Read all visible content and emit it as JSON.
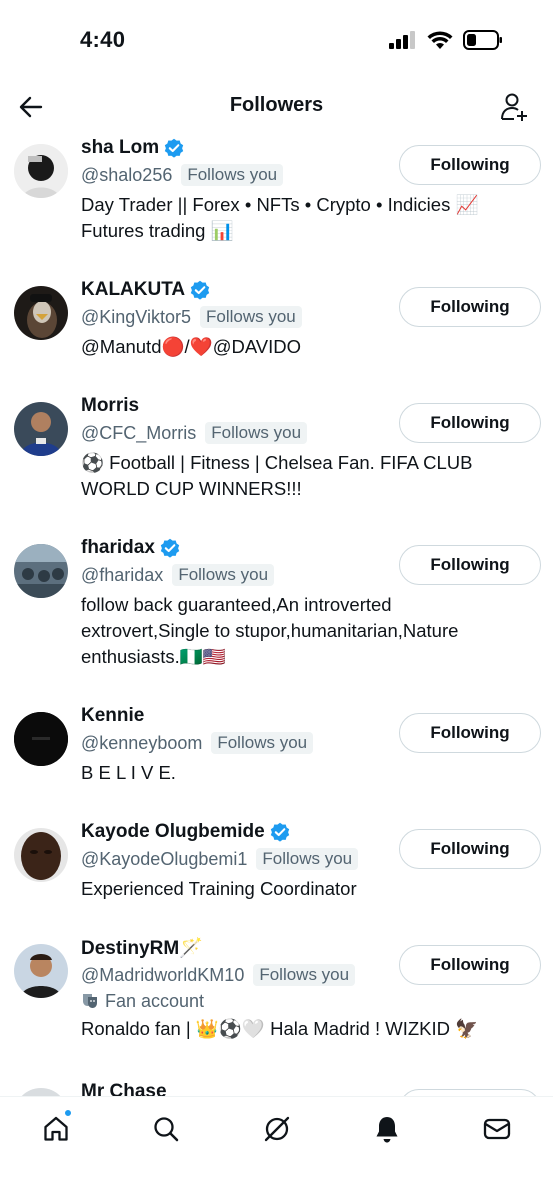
{
  "status_bar": {
    "time": "4:40"
  },
  "header": {
    "title": "Followers"
  },
  "users": [
    {
      "name": "sha Lom",
      "handle": "@shalo256",
      "follows_you": "Follows you",
      "verified": true,
      "bio": [
        "Day Trader || Forex • NFTs • Crypto • Indicies 📈",
        "Futures trading 📊"
      ],
      "button": "Following"
    },
    {
      "name": "KALAKUTA",
      "handle": "@KingViktor5",
      "follows_you": "Follows you",
      "verified": true,
      "bio": [
        "@Manutd🔴/❤️@DAVIDO"
      ],
      "button": "Following"
    },
    {
      "name": "Morris",
      "handle": "@CFC_Morris",
      "follows_you": "Follows you",
      "verified": false,
      "bio": [
        "⚽ Football | Fitness | Chelsea Fan. FIFA CLUB",
        "WORLD CUP WINNERS!!!"
      ],
      "button": "Following"
    },
    {
      "name": "fharidax",
      "handle": "@fharidax",
      "follows_you": "Follows you",
      "verified": true,
      "bio": [
        "follow back guaranteed,An introverted",
        "extrovert,Single to stupor,humanitarian,Nature",
        "enthusiasts.🇳🇬🇺🇸"
      ],
      "button": "Following"
    },
    {
      "name": "Kennie",
      "handle": "@kenneyboom",
      "follows_you": "Follows you",
      "verified": false,
      "bio": [
        "B E L I V E."
      ],
      "button": "Following"
    },
    {
      "name": "Kayode Olugbemide",
      "handle": "@KayodeOlugbemi1",
      "follows_you": "Follows you",
      "verified": true,
      "bio": [
        "Experienced Training Coordinator"
      ],
      "button": "Following"
    },
    {
      "name": "DestinyRM🪄",
      "handle": "@MadridworldKM10",
      "follows_you": "Follows you",
      "verified": false,
      "sub": "Fan account",
      "bio": [
        "Ronaldo fan | 👑⚽🤍 Hala Madrid ! WIZKID 🦅"
      ],
      "button": "Following"
    },
    {
      "name": "Mr Chase",
      "handle": "",
      "follows_you": "",
      "verified": false,
      "bio": [],
      "button": ""
    }
  ],
  "tab_bar": {
    "items": [
      "home-icon",
      "search-icon",
      "grok-icon",
      "notifications-icon",
      "messages-icon"
    ],
    "active": "notifications-icon"
  },
  "colors": {
    "accent": "#1d9bf0",
    "text": "#0f1419",
    "secondary": "#536471",
    "badge_bg": "#eff3f4"
  }
}
